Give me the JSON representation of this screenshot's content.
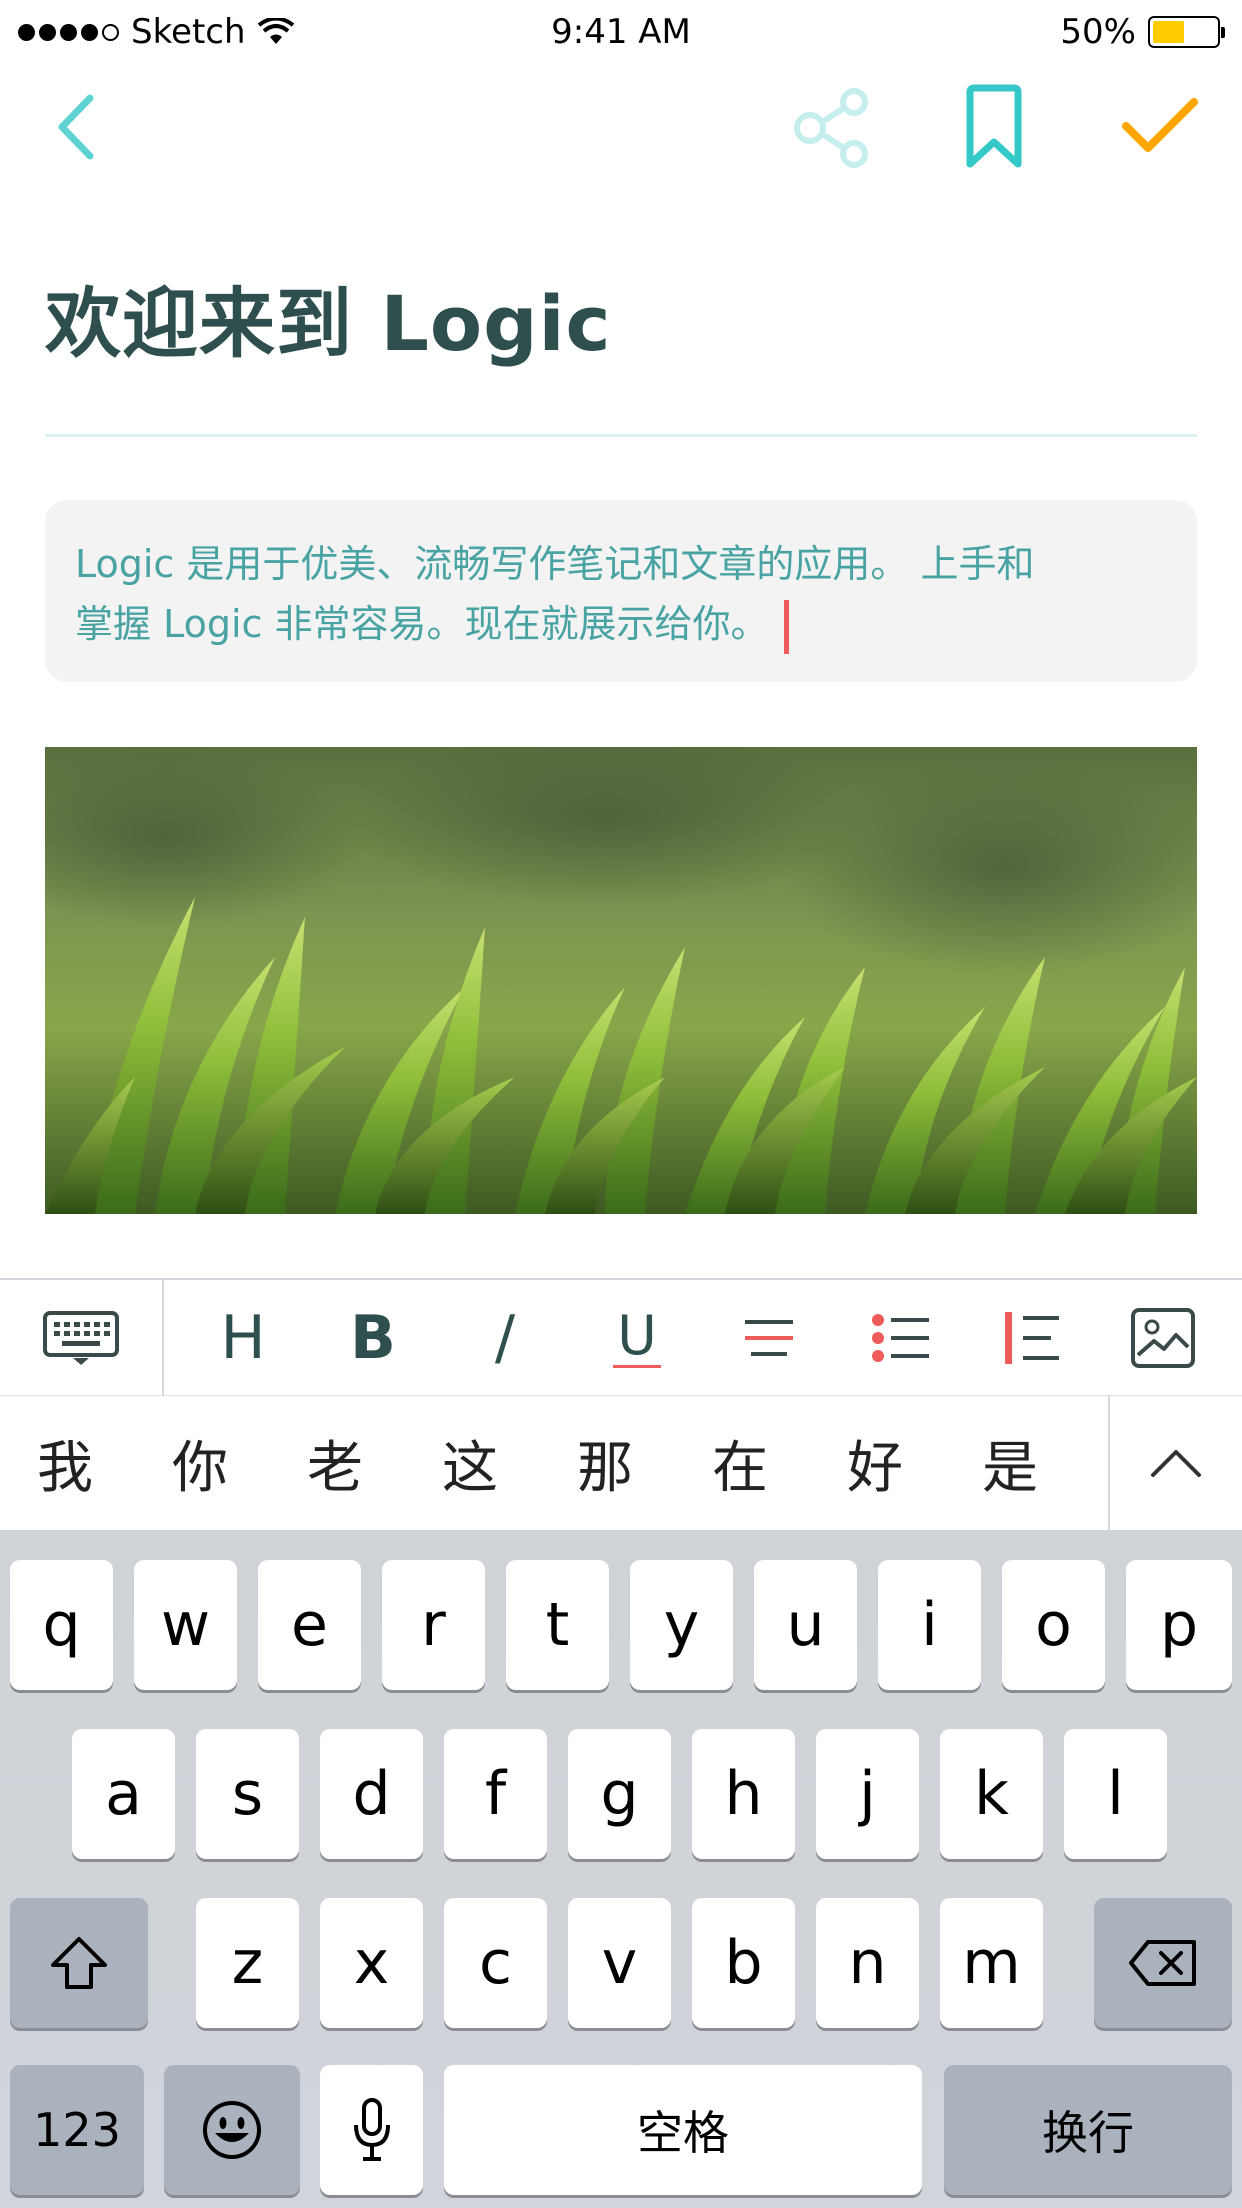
{
  "status_bar": {
    "carrier": "Sketch",
    "time": "9:41 AM",
    "battery": "50%",
    "battery_level": 0.5,
    "battery_color": "#ffcc00"
  },
  "nav": {
    "back_icon": "chevron-left-icon",
    "share_icon": "share-icon",
    "bookmark_icon": "bookmark-icon",
    "done_icon": "checkmark-icon",
    "accent_color": "#34c8c8",
    "done_color": "#ffa500"
  },
  "document": {
    "title": "欢迎来到 Logic",
    "quote_line1": "Logic 是用于优美、流畅写作笔记和文章的应用。 上手和",
    "quote_line2": "掌握 Logic 非常容易。现在就展示给你。",
    "image": "grass-photo"
  },
  "format_bar": {
    "keyboard_icon": "keyboard-icon",
    "heading": "H",
    "bold": "B",
    "italic": "/",
    "underline": "U",
    "strike_icon": "strikethrough-icon",
    "list_icon": "bulleted-list-icon",
    "quote_icon": "blockquote-icon",
    "image_icon": "insert-image-icon"
  },
  "candidates": {
    "items": [
      "我",
      "你",
      "老",
      "这",
      "那",
      "在",
      "好",
      "是"
    ],
    "expand_icon": "chevron-up-icon"
  },
  "keyboard": {
    "row1": [
      "q",
      "w",
      "e",
      "r",
      "t",
      "y",
      "u",
      "i",
      "o",
      "p"
    ],
    "row2": [
      "a",
      "s",
      "d",
      "f",
      "g",
      "h",
      "j",
      "k",
      "l"
    ],
    "row3": [
      "z",
      "x",
      "c",
      "v",
      "b",
      "n",
      "m"
    ],
    "shift_icon": "shift-icon",
    "delete_icon": "delete-icon",
    "numbers": "123",
    "emoji_icon": "emoji-icon",
    "mic_icon": "microphone-icon",
    "space": "空格",
    "return": "换行"
  }
}
